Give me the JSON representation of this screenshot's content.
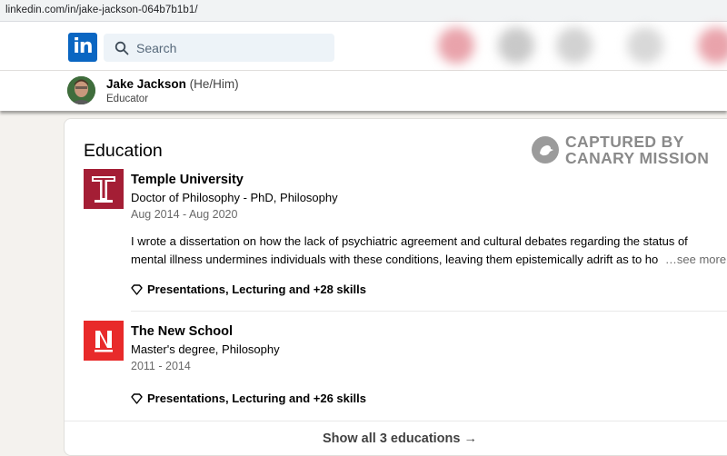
{
  "browser": {
    "url": "linkedin.com/in/jake-jackson-064b7b1b1/"
  },
  "nav": {
    "logo_text": "in",
    "search_placeholder": "Search"
  },
  "profile": {
    "name": "Jake Jackson",
    "pronouns": "(He/Him)",
    "headline": "Educator"
  },
  "watermark": {
    "line1": "CAPTURED BY",
    "line2": "CANARY MISSION"
  },
  "education": {
    "title": "Education",
    "entries": [
      {
        "school": "Temple University",
        "degree": "Doctor of Philosophy - PhD, Philosophy",
        "dates": "Aug 2014 - Aug 2020",
        "description_line1": "I wrote a dissertation on how the lack of psychiatric agreement and cultural debates regarding the status of",
        "description_line2": "mental illness undermines individuals with these conditions, leaving them epistemically adrift as to ho",
        "see_more": "…see more",
        "skills": "Presentations, Lecturing and +28 skills",
        "logo_color": "#a41e35"
      },
      {
        "school": "The New School",
        "degree": "Master's degree, Philosophy",
        "dates": "2011 - 2014",
        "skills": "Presentations, Lecturing and +26 skills",
        "logo_color": "#e82a2a"
      }
    ],
    "show_all": "Show all 3 educations →"
  },
  "colors": {
    "linkedin_blue": "#0a66c2",
    "temple_red": "#a41e35",
    "newschool_red": "#e82a2a"
  }
}
